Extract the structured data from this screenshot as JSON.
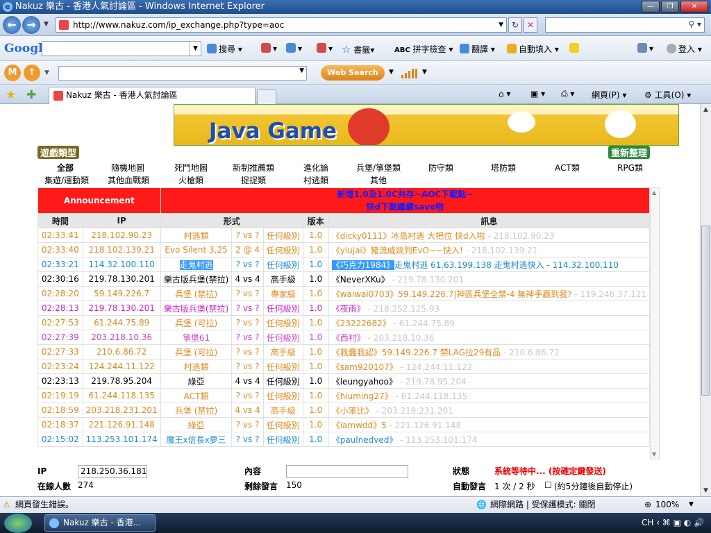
{
  "window": {
    "title": "Nakuz 樂古 - 香港人氣討論區 - Windows Internet Explorer"
  },
  "address": {
    "url": "http://www.nakuz.com/ip_exchange.php?type=aoc"
  },
  "googlebar": {
    "logo": "Google",
    "search": "搜尋 ▾",
    "bookmarks": "書籤▾",
    "spellcheck": "拼字檢查 ▾",
    "translate": "翻譯 ▾",
    "autofill": "自動填入 ▾",
    "signin": "登入 ▾"
  },
  "mbar": {
    "websearch": "Web Search"
  },
  "tab": {
    "label": "Nakuz 樂古 - 香港人氣討論區"
  },
  "commandbar": {
    "page": "網頁(P) ▾",
    "tools": "工具(O) ▾"
  },
  "banner": {
    "text": "Java Game"
  },
  "categories": {
    "title": "遊戲類型",
    "reset": "重新整理",
    "row1": [
      "全部",
      "隨機地圖",
      "死鬥地圖",
      "新制推薦類",
      "進化論",
      "兵堡/箏堡類",
      "防守類",
      "塔防類",
      "ACT類",
      "RPG類"
    ],
    "row2": [
      "集遊/運動類",
      "其他血戰類",
      "火槍類",
      "捉捉類",
      "村逃類",
      "其他"
    ]
  },
  "announcement": {
    "label": "Announcement",
    "line1": "新增1.0及1.0C共存~AOC下載點~",
    "line2": "快d下載繼續save啦"
  },
  "table": {
    "headers": [
      "時間",
      "IP",
      "形式",
      "版本",
      "訊息"
    ],
    "rows": [
      {
        "time": "02:33:41",
        "ip": "218.102.90.23",
        "map": "村逃類",
        "vs": "? vs ?",
        "level": "任何級別",
        "ver": "1.0",
        "user": "《dicky0111》",
        "msg": "冰島村逃 大把位 快d入啦",
        "msgip": " - 218.102.90.23",
        "color": "#e08a1e"
      },
      {
        "time": "02:33:40",
        "ip": "218.102.139.21",
        "map": "Evo Silent 3,25",
        "vs": "2 @ 4",
        "level": "任何級別",
        "ver": "1.0",
        "user": "《yiujai》",
        "msg": "豬流威燚到EvO~~快入!",
        "msgip": " - 218.102.139.21",
        "color": "#e08a1e"
      },
      {
        "time": "02:33:21",
        "ip": "114.32.100.110",
        "map": "走鬼村逃",
        "vs": "? vs ?",
        "level": "任何級別",
        "ver": "1.0",
        "user": "《巧克力1984》",
        "msg": "走鬼村逃 61.63.199.138 走鬼村逃快入 - 114.32.100.110",
        "msgip": "",
        "color": "#1a8ad4"
      },
      {
        "time": "02:30:16",
        "ip": "219.78.130.201",
        "map": "樂古版兵堡(禁拉)",
        "vs": "4 vs 4",
        "level": "高手級",
        "ver": "1.0",
        "user": "《NeverXKu》",
        "msg": "",
        "msgip": " - 219.78.130.201",
        "color": "#000000"
      },
      {
        "time": "02:28:20",
        "ip": "59.149.226.7",
        "map": "兵堡 (禁拉)",
        "vs": "? vs ?",
        "level": "專家級",
        "ver": "1.0",
        "user": "《waiwai0703》",
        "msg": "59.149.226.7|神區兵堡全禁-4 無神手贏到我?",
        "msgip": " - 119.246.37.121",
        "color": "#e08a1e"
      },
      {
        "time": "02:28:13",
        "ip": "219.78.130.201",
        "map": "樂古版兵堡(禁拉)",
        "vs": "? vs ?",
        "level": "任何級別",
        "ver": "1.0",
        "user": "《夜雨》",
        "msg": "",
        "msgip": " - 218.252.125.93",
        "color": "#cc22cc"
      },
      {
        "time": "02:27:53",
        "ip": "61.244.75.89",
        "map": "兵堡 (可拉)",
        "vs": "? vs ?",
        "level": "任何級別",
        "ver": "1.0",
        "user": "《23222682》",
        "msg": "",
        "msgip": " - 61.244.75.89",
        "color": "#e08a1e"
      },
      {
        "time": "02:27:39",
        "ip": "203.218.10.36",
        "map": "箏堡61",
        "vs": "? vs ?",
        "level": "任何級別",
        "ver": "1.0",
        "user": "《西村》",
        "msg": "",
        "msgip": " - 203.218.10.36",
        "color": "#cc44cc"
      },
      {
        "time": "02:27:33",
        "ip": "210.6.86.72",
        "map": "兵堡 (可拉)",
        "vs": "? vs ?",
        "level": "高手級",
        "ver": "1.0",
        "user": "《我蠢我認》",
        "msg": "59.149.226.7 禁LAG拉29有品",
        "msgip": " - 210.6.86.72",
        "color": "#e08a1e"
      },
      {
        "time": "02:23:24",
        "ip": "124.244.11.122",
        "map": "村逃類",
        "vs": "? vs ?",
        "level": "任何級別",
        "ver": "1.0",
        "user": "《sam920107》",
        "msg": "",
        "msgip": " - 124.244.11.122",
        "color": "#e08a1e"
      },
      {
        "time": "02:23:13",
        "ip": "219.78.95.204",
        "map": "綠亞",
        "vs": "4 vs 4",
        "level": "任何級別",
        "ver": "1.0",
        "user": "《leungyahoo》",
        "msg": "",
        "msgip": " - 219.78.95.204",
        "color": "#000000"
      },
      {
        "time": "02:19:19",
        "ip": "61.244.118.135",
        "map": "ACT類",
        "vs": "? vs ?",
        "level": "任何級別",
        "ver": "1.0",
        "user": "《hiuming27》",
        "msg": "",
        "msgip": " - 61.244.118.135",
        "color": "#e08a1e"
      },
      {
        "time": "02:18:59",
        "ip": "203.218.231.201",
        "map": "兵堡 (禁拉)",
        "vs": "4 vs 4",
        "level": "高手級",
        "ver": "1.0",
        "user": "《小笨比》",
        "msg": "",
        "msgip": " - 203.218.231.201",
        "color": "#e08a1e"
      },
      {
        "time": "02:18:37",
        "ip": "221.126.91.148",
        "map": "綠亞",
        "vs": "? vs ?",
        "level": "任何級別",
        "ver": "1.0",
        "user": "《iamwdd》",
        "msg": "5",
        "msgip": " - 221.126.91.148",
        "color": "#e08a1e"
      },
      {
        "time": "02:15:02",
        "ip": "113.253.101.174",
        "map": "魔王x信長x夢三",
        "vs": "? vs ?",
        "level": "任何級別",
        "ver": "1.0",
        "user": "《paulnedved》",
        "msg": "",
        "msgip": " - 113.253.101.174",
        "color": "#1a8ad4"
      }
    ]
  },
  "form": {
    "ip_label": "IP",
    "ip_value": "218.250.36.181",
    "online_label": "在線人數",
    "online_value": "274",
    "content_label": "內容",
    "remaining_label": "剩餘發言",
    "remaining_value": "150",
    "status_label": "狀態",
    "status_value": "系統等待中... (按確定鍵發送)",
    "auto_label": "自動發言",
    "auto_value": "1 次 / 2 秒",
    "auto_note": "(約5分鐘後自動停止)"
  },
  "statusbar": {
    "error": "網頁發生錯誤。",
    "zone": "網際網路 | 受保護模式: 關閉",
    "zoom": "100%"
  },
  "taskbar": {
    "button": "Nakuz 樂古 - 香港...",
    "lang": "CH"
  }
}
